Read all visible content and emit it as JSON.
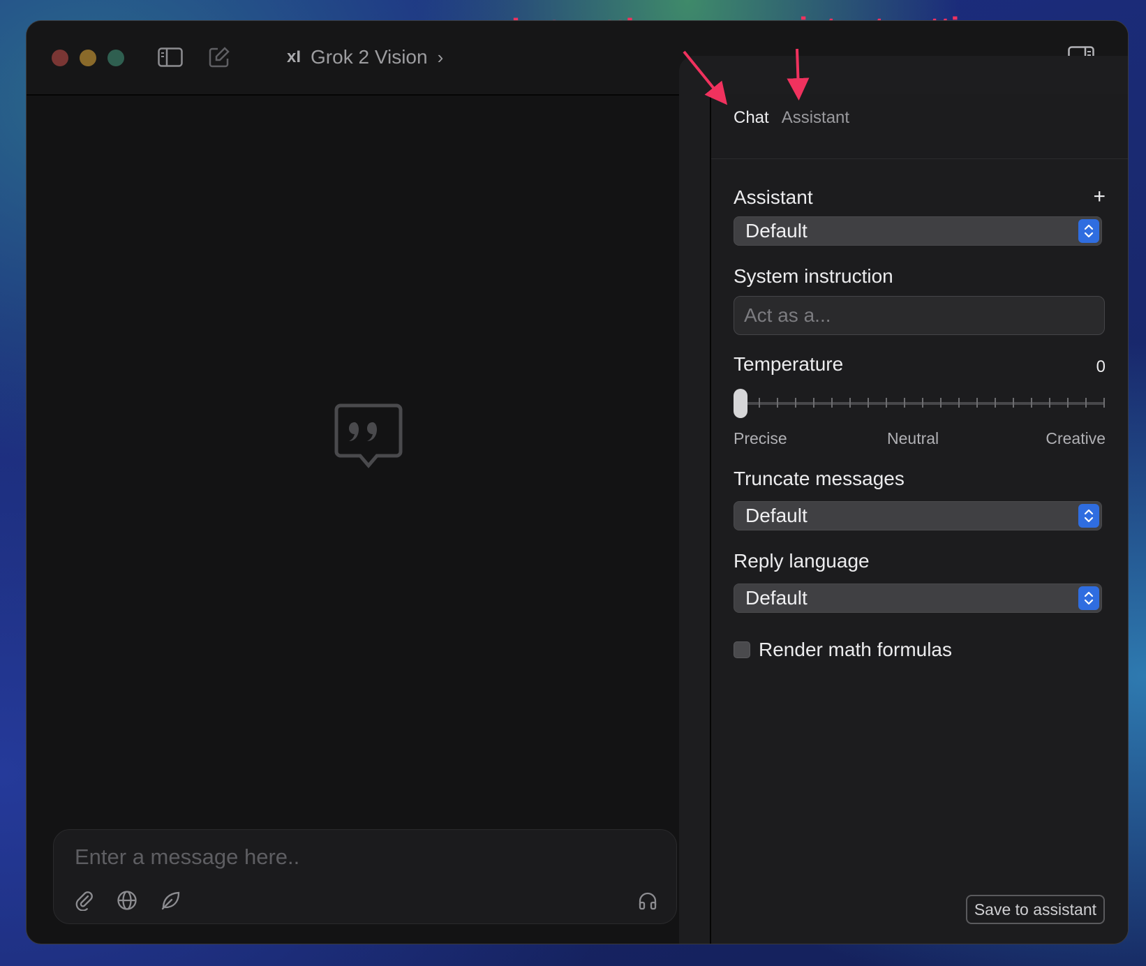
{
  "window": {
    "title": "Grok 2 Vision",
    "title_logo": "xI"
  },
  "annotations": {
    "chat": "chat settings",
    "assistant": "assistant settings",
    "color": "#f0325e"
  },
  "settings": {
    "tabs": [
      {
        "label": "Chat",
        "active": true
      },
      {
        "label": "Assistant",
        "active": false
      }
    ],
    "assistant_label": "Assistant",
    "assistant_value": "Default",
    "system_instruction_label": "System instruction",
    "system_instruction_placeholder": "Act as a...",
    "temperature_label": "Temperature",
    "temperature_value": "0",
    "temperature_level": 0,
    "temperature_scale": {
      "min": "Precise",
      "mid": "Neutral",
      "max": "Creative"
    },
    "truncate_label": "Truncate messages",
    "truncate_value": "Default",
    "reply_language_label": "Reply language",
    "reply_language_value": "Default",
    "render_math_label": "Render math formulas",
    "render_math_checked": false,
    "save_button": "Save to assistant"
  },
  "composer": {
    "placeholder": "Enter a message here.."
  },
  "colors": {
    "accent": "#2f6de0",
    "annotation": "#f0325e"
  }
}
